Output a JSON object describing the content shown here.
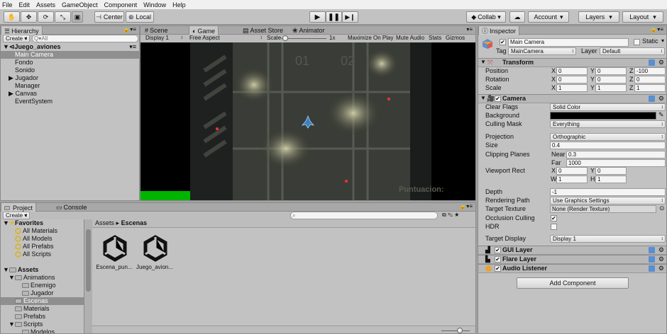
{
  "menu": [
    "File",
    "Edit",
    "Assets",
    "GameObject",
    "Component",
    "Window",
    "Help"
  ],
  "toolbar": {
    "pivot_label": "Center",
    "space_label": "Local",
    "collab_label": "Collab ▾",
    "account_label": "Account",
    "layers_label": "Layers",
    "layout_label": "Layout"
  },
  "hierarchy": {
    "tab": "Hierarchy",
    "create_label": "Create ▾",
    "search_placeholder": "Q▾All",
    "scene_name": "Juego_aviones",
    "items": [
      "Main Camera",
      "Fondo",
      "Sonido",
      "Jugador",
      "Manager",
      "Canvas",
      "EventSystem"
    ]
  },
  "scene_tabs": [
    "Scene",
    "Game",
    "Asset Store",
    "Animator"
  ],
  "game_toolbar": {
    "display": "Display 1",
    "aspect": "Free Aspect",
    "scale_label": "Scale",
    "scale_value": "1x",
    "maximize": "Maximize On Play",
    "mute": "Mute Audio",
    "stats": "Stats",
    "gizmos": "Gizmos"
  },
  "game_view": {
    "hud_text": "Puntuacion:",
    "markings": [
      "01",
      "02"
    ],
    "health_color": "#00b400"
  },
  "project": {
    "tabs": [
      "Project",
      "Console"
    ],
    "create_label": "Create ▾",
    "favorites_label": "Favorites",
    "favorites": [
      "All Materials",
      "All Models",
      "All Prefabs",
      "All Scripts"
    ],
    "assets_label": "Assets",
    "tree": [
      "Animations",
      "Enemigo",
      "Jugador",
      "Escenas",
      "Materials",
      "Prefabs",
      "Scripts",
      "Modelos"
    ],
    "breadcrumb_root": "Assets",
    "breadcrumb_current": "Escenas",
    "files": [
      "Escena_pun...",
      "Juego_avion..."
    ]
  },
  "inspector": {
    "tab": "Inspector",
    "object_name": "Main Camera",
    "static_label": "Static",
    "tag_label": "Tag",
    "tag_value": "MainCamera",
    "layer_label": "Layer",
    "layer_value": "Default",
    "transform": {
      "title": "Transform",
      "position": {
        "label": "Position",
        "x": "0",
        "y": "0",
        "z": "-100"
      },
      "rotation": {
        "label": "Rotation",
        "x": "0",
        "y": "0",
        "z": "0"
      },
      "scale": {
        "label": "Scale",
        "x": "1",
        "y": "1",
        "z": "1"
      }
    },
    "camera": {
      "title": "Camera",
      "clear_flags_label": "Clear Flags",
      "clear_flags": "Solid Color",
      "background_label": "Background",
      "background_color": "#000000",
      "culling_mask_label": "Culling Mask",
      "culling_mask": "Everything",
      "projection_label": "Projection",
      "projection": "Orthographic",
      "size_label": "Size",
      "size": "0.4",
      "clipping_label": "Clipping Planes",
      "near_label": "Near",
      "near": "0.3",
      "far_label": "Far",
      "far": "1000",
      "viewport_label": "Viewport Rect",
      "vx": "0",
      "vy": "0",
      "vw": "1",
      "vh": "1",
      "depth_label": "Depth",
      "depth": "-1",
      "rendering_path_label": "Rendering Path",
      "rendering_path": "Use Graphics Settings",
      "target_texture_label": "Target Texture",
      "target_texture": "None (Render Texture)",
      "occlusion_label": "Occlusion Culling",
      "hdr_label": "HDR",
      "target_display_label": "Target Display",
      "target_display": "Display 1"
    },
    "gui_layer": "GUI Layer",
    "flare_layer": "Flare Layer",
    "audio_listener": "Audio Listener",
    "add_component": "Add Component"
  }
}
